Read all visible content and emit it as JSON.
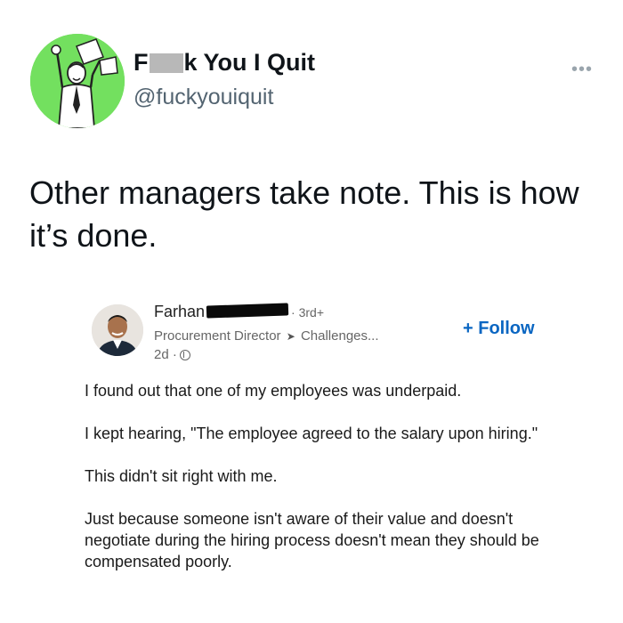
{
  "tweet": {
    "display_name_start": "F",
    "display_name_end": "k You I Quit",
    "handle": "@fuckyouiquit",
    "more_icon": "more-dots-icon",
    "text": "Other managers take note. This is how it’s done."
  },
  "embedded_post": {
    "author_first_name": "Farhan",
    "connection_degree": "· 3rd+",
    "headline_left": "Procurement Director",
    "headline_right": "Challenges...",
    "posted_ago": "2d ·",
    "visibility_icon": "globe-icon",
    "follow_label": "+ Follow",
    "paragraphs": [
      "I found out that one of my employees was underpaid.",
      "I kept hearing, \"The employee agreed to the salary upon hiring.\"",
      "This didn't sit right with me.",
      "Just because someone isn't aware of their value and doesn't negotiate during the hiring process doesn't mean they should be compensated poorly."
    ]
  },
  "colors": {
    "avatar_bg": "#73e05f",
    "link_blue": "#0a66c2",
    "handle_gray": "#536471"
  }
}
